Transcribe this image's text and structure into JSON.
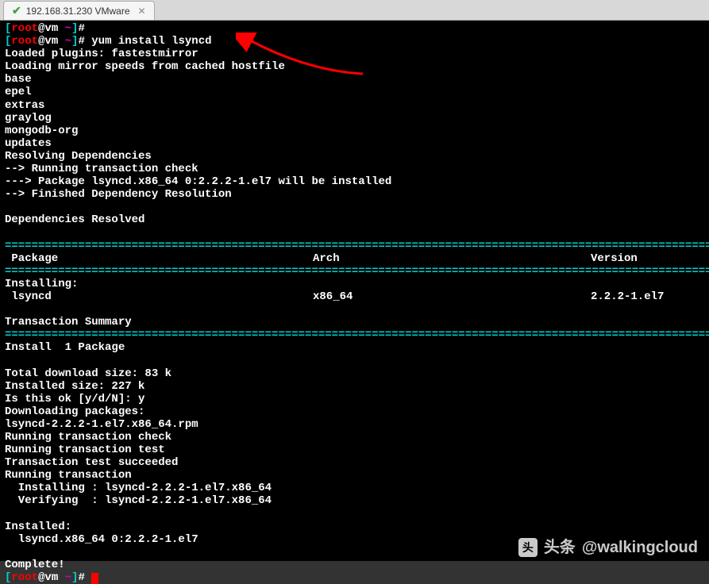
{
  "tab": {
    "title": "192.168.31.230 VMware"
  },
  "prompt": {
    "user": "root",
    "host": "vm",
    "path": "~",
    "symbol": "#"
  },
  "cmd": "yum install lsyncd",
  "out": {
    "l1": "Loaded plugins: fastestmirror",
    "l2": "Loading mirror speeds from cached hostfile",
    "l3": "base",
    "l4": "epel",
    "l5": "extras",
    "l6": "graylog",
    "l7": "mongodb-org",
    "l8": "updates",
    "l9": "Resolving Dependencies",
    "l10": "--> Running transaction check",
    "l11": "---> Package lsyncd.x86_64 0:2.2.2-1.el7 will be installed",
    "l12": "--> Finished Dependency Resolution",
    "l13": "Dependencies Resolved"
  },
  "table": {
    "hdr_pkg": " Package",
    "hdr_arch": "Arch",
    "hdr_ver": "Version",
    "installing": "Installing:",
    "pkg": " lsyncd",
    "arch": "x86_64",
    "ver": "2.2.2-1.el7",
    "summary": "Transaction Summary"
  },
  "install": {
    "l1": "Install  1 Package",
    "l2": "Total download size: 83 k",
    "l3": "Installed size: 227 k",
    "l4": "Is this ok [y/d/N]: y",
    "l5": "Downloading packages:",
    "l6": "lsyncd-2.2.2-1.el7.x86_64.rpm",
    "l7": "Running transaction check",
    "l8": "Running transaction test",
    "l9": "Transaction test succeeded",
    "l10": "Running transaction",
    "l11": "  Installing : lsyncd-2.2.2-1.el7.x86_64",
    "l12": "  Verifying  : lsyncd-2.2.2-1.el7.x86_64",
    "l13": "Installed:",
    "l14": "  lsyncd.x86_64 0:2.2.2-1.el7",
    "l15": "Complete!"
  },
  "sep": "====================================================================================================================",
  "watermark": "@walkingcloud",
  "watermark_prefix": "头条"
}
